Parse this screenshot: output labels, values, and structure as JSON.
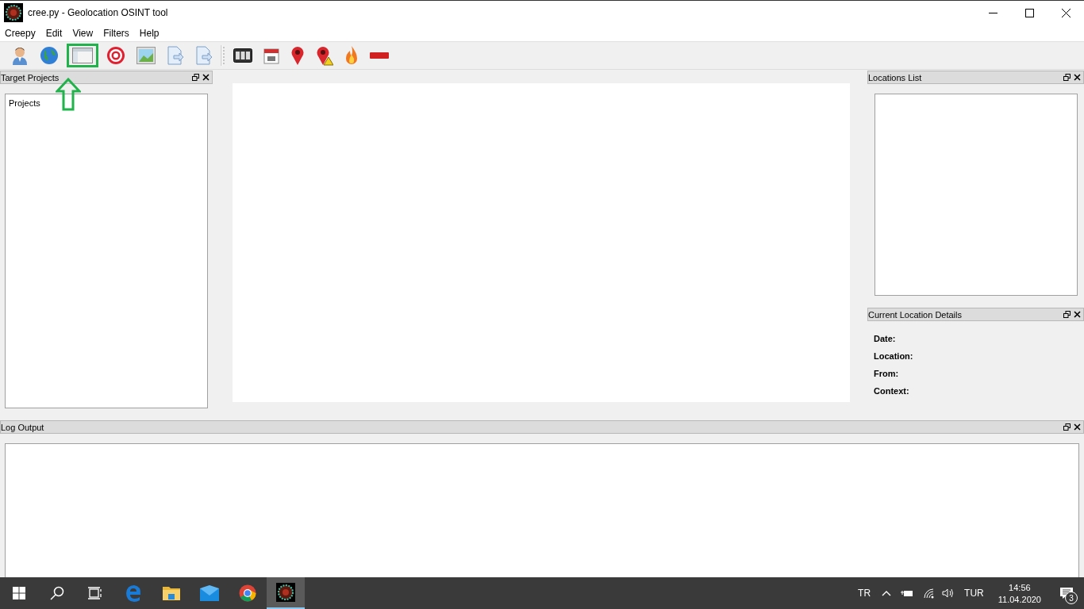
{
  "window": {
    "title": "cree.py - Geolocation OSINT tool"
  },
  "menu": [
    "Creepy",
    "Edit",
    "View",
    "Filters",
    "Help"
  ],
  "toolbar": [
    [
      {
        "kind": "person",
        "highlighted": false
      },
      {
        "kind": "globe",
        "highlighted": false
      },
      {
        "kind": "window",
        "highlighted": true
      },
      {
        "kind": "target",
        "highlighted": false
      },
      {
        "kind": "image",
        "highlighted": false
      },
      {
        "kind": "export",
        "highlighted": false
      },
      {
        "kind": "export",
        "highlighted": false
      }
    ],
    [
      {
        "kind": "counter",
        "highlighted": false
      },
      {
        "kind": "calendar",
        "highlighted": false
      },
      {
        "kind": "pin",
        "highlighted": false
      },
      {
        "kind": "pinwarn",
        "highlighted": false
      },
      {
        "kind": "flame",
        "highlighted": false
      },
      {
        "kind": "minus",
        "highlighted": false
      }
    ]
  ],
  "target_projects": {
    "title": "Target Projects",
    "tree": [
      {
        "label": "Projects"
      }
    ]
  },
  "locations_list": {
    "title": "Locations List"
  },
  "current_location_details": {
    "title": "Current Location Details",
    "fields": [
      "Date:",
      "Location:",
      "From:",
      "Context:"
    ]
  },
  "log_output": {
    "title": "Log Output"
  },
  "taskbar": {
    "apps": [
      {
        "kind": "edge",
        "selected": false
      },
      {
        "kind": "folder",
        "selected": false
      },
      {
        "kind": "mail",
        "selected": false
      },
      {
        "kind": "chrome",
        "selected": false
      },
      {
        "kind": "creepy",
        "selected": true
      }
    ],
    "input_indicator": "TR",
    "language": "TUR",
    "time": "14:56",
    "date": "11.04.2020",
    "notifications": "3"
  }
}
